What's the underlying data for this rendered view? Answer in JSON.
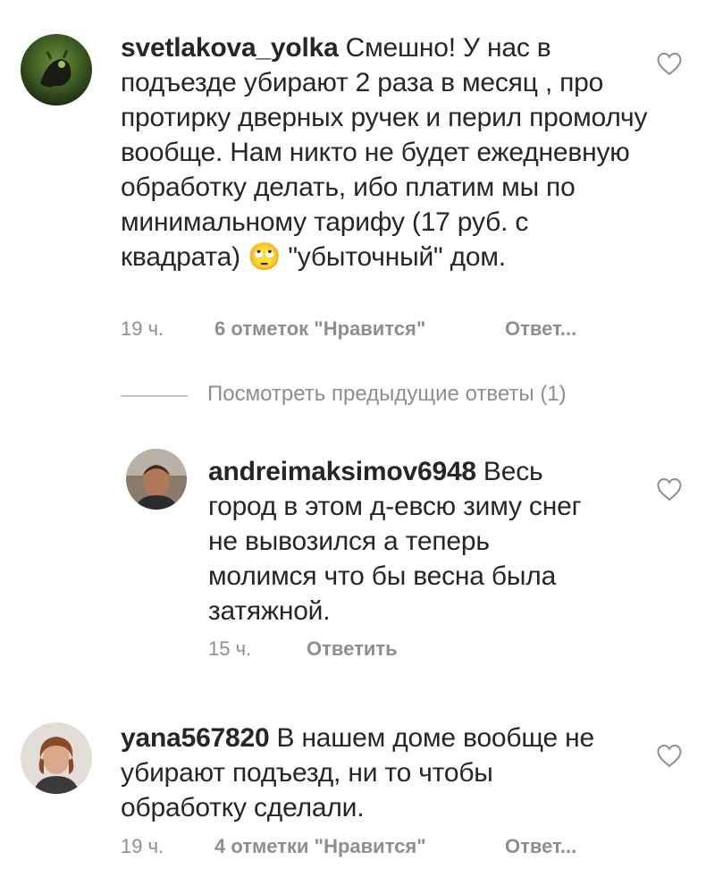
{
  "view_previous_replies": "Посмотреть предыдущие ответы (1)",
  "comments": [
    {
      "username": "svetlakova_yolka",
      "text": "Смешно! У нас в подъезде убирают 2 раза в месяц , про протирку дверных ручек и перил промолчу вообще. Нам никто не будет ежедневную обработку делать, ибо платим мы по минимальному тарифу (17 руб. с квадрата) 🙄 \"убыточный\" дом.",
      "time": "19 ч.",
      "likes": "6 отметок \"Нравится\"",
      "reply": "Ответ..."
    },
    {
      "username": "andreimaksimov6948",
      "text": "Весь город в этом д-евсю зиму снег не вывозился а теперь молимся что бы весна была затяжной.",
      "time": "15 ч.",
      "reply": "Ответить"
    },
    {
      "username": "yana567820",
      "text": "В нашем доме вообще не убирают подъезд, ни то чтобы обработку сделали.",
      "time": "19 ч.",
      "likes": "4 отметки \"Нравится\"",
      "reply": "Ответ..."
    }
  ],
  "icons": {
    "like": "heart-outline-icon",
    "emoji": "face-with-rolling-eyes-emoji"
  },
  "colors": {
    "text": "#262626",
    "secondary": "#8e8e8e",
    "divider": "#c7c7c7"
  }
}
